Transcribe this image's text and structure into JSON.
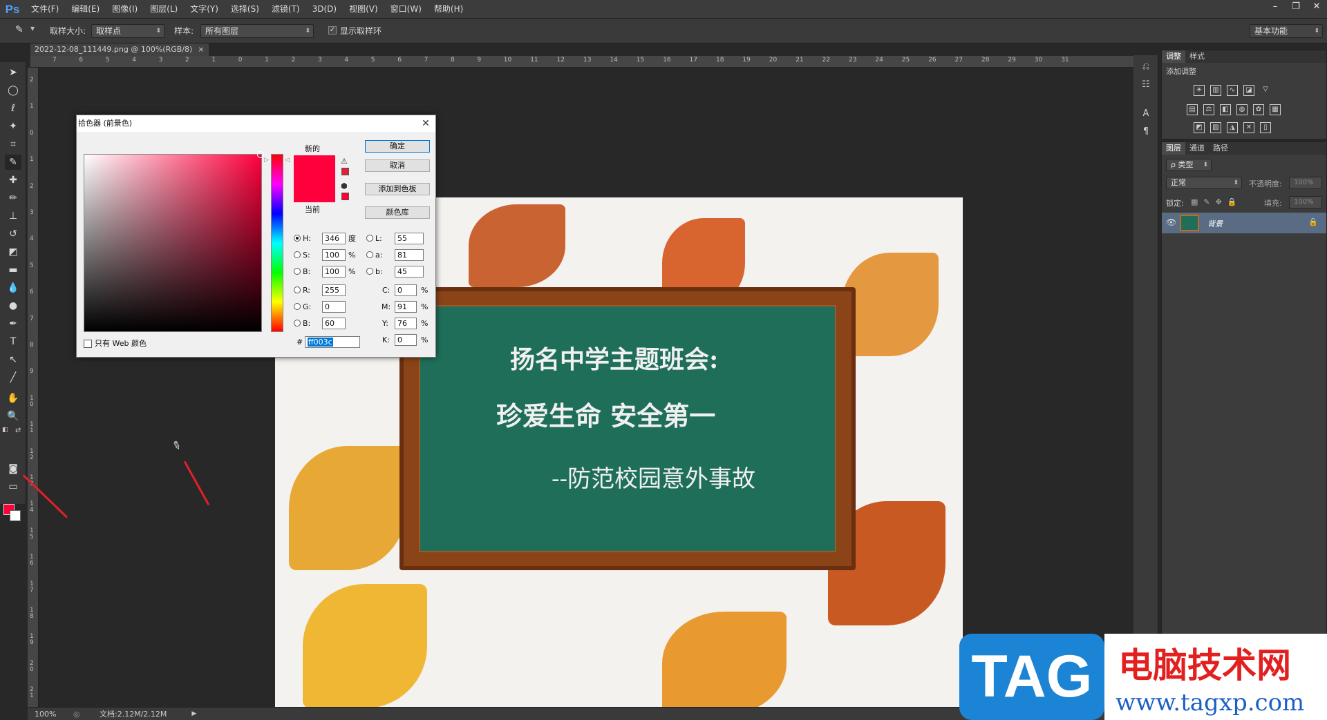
{
  "app": {
    "logo": "Ps"
  },
  "menubar": {
    "items": [
      "文件(F)",
      "编辑(E)",
      "图像(I)",
      "图层(L)",
      "文字(Y)",
      "选择(S)",
      "滤镜(T)",
      "3D(D)",
      "视图(V)",
      "窗口(W)",
      "帮助(H)"
    ]
  },
  "window_controls": {
    "minimize": "–",
    "restore": "❐",
    "close": "✕"
  },
  "options": {
    "sample_size_label": "取样大小:",
    "sample_size_value": "取样点",
    "sample_label": "样本:",
    "sample_value": "所有图层",
    "show_ring_label": "显示取样环",
    "show_ring_checked": true,
    "workspace": "基本功能"
  },
  "document": {
    "tab_title": "2022-12-08_111449.png @ 100%(RGB/8)",
    "tab_close": "×"
  },
  "ruler": {
    "h_ticks": [
      "7",
      "6",
      "5",
      "4",
      "3",
      "2",
      "1",
      "0",
      "1",
      "2",
      "3",
      "4",
      "5",
      "6",
      "7",
      "8",
      "9",
      "10",
      "11",
      "12",
      "13",
      "14",
      "15",
      "16",
      "17",
      "18",
      "19",
      "20",
      "21",
      "22",
      "23",
      "24",
      "25",
      "26",
      "27",
      "28",
      "29",
      "30",
      "31"
    ],
    "v_ticks": [
      "2",
      "1",
      "0",
      "1",
      "2",
      "3",
      "4",
      "5",
      "6",
      "7",
      "8",
      "9",
      "1 0",
      "1 1",
      "1 2",
      "1 3",
      "1 4",
      "1 5",
      "1 6",
      "1 7",
      "1 8",
      "1 9",
      "2 0",
      "2 1"
    ]
  },
  "image": {
    "line1": "扬名中学主题班会:",
    "line2": "珍爱生命    安全第一",
    "line3": "--防范校园意外事故"
  },
  "status": {
    "zoom": "100%",
    "doc": "文档:2.12M/2.12M"
  },
  "adjustments_panel": {
    "tabs": [
      "调整",
      "样式"
    ],
    "title": "添加调整"
  },
  "layers_panel": {
    "tabs": [
      "图层",
      "通道",
      "路径"
    ],
    "filter": "ρ 类型",
    "blend_mode": "正常",
    "opacity_label": "不透明度:",
    "opacity": "100%",
    "lock_label": "锁定:",
    "fill_label": "填充:",
    "fill": "100%",
    "layer_name": "背景"
  },
  "color_picker": {
    "title": "拾色器 (前景色)",
    "new_label": "新的",
    "current_label": "当前",
    "new_color": "#ff003c",
    "current_color": "#ff003c",
    "buttons": {
      "ok": "确定",
      "cancel": "取消",
      "add_swatch": "添加到色板",
      "libraries": "颜色库"
    },
    "hsb": {
      "h": "346",
      "h_unit": "度",
      "s": "100",
      "s_unit": "%",
      "b": "100",
      "b_unit": "%"
    },
    "lab": {
      "l": "55",
      "a": "81",
      "b": "45"
    },
    "rgb": {
      "r": "255",
      "g": "0",
      "b": "60"
    },
    "cmyk": {
      "c": "0",
      "m": "91",
      "y": "76",
      "k": "0",
      "unit": "%"
    },
    "hex_label": "#",
    "hex": "ff003c",
    "web_only_label": "只有 Web 颜色",
    "labels": {
      "h": "H:",
      "s": "S:",
      "b": "B:",
      "l": "L:",
      "a": "a:",
      "lab_b": "b:",
      "r": "R:",
      "g": "G:",
      "rgb_b": "B:",
      "c": "C:",
      "m": "M:",
      "y": "Y:",
      "k": "K:"
    }
  },
  "watermark": {
    "tag": "TAG",
    "cn": "电脑技术网",
    "url": "www.tagxp.com"
  },
  "colors": {
    "foreground": "#ff003c",
    "background": "#ffffff",
    "board": "#1f6e5a",
    "accent": "#1b84d4"
  }
}
